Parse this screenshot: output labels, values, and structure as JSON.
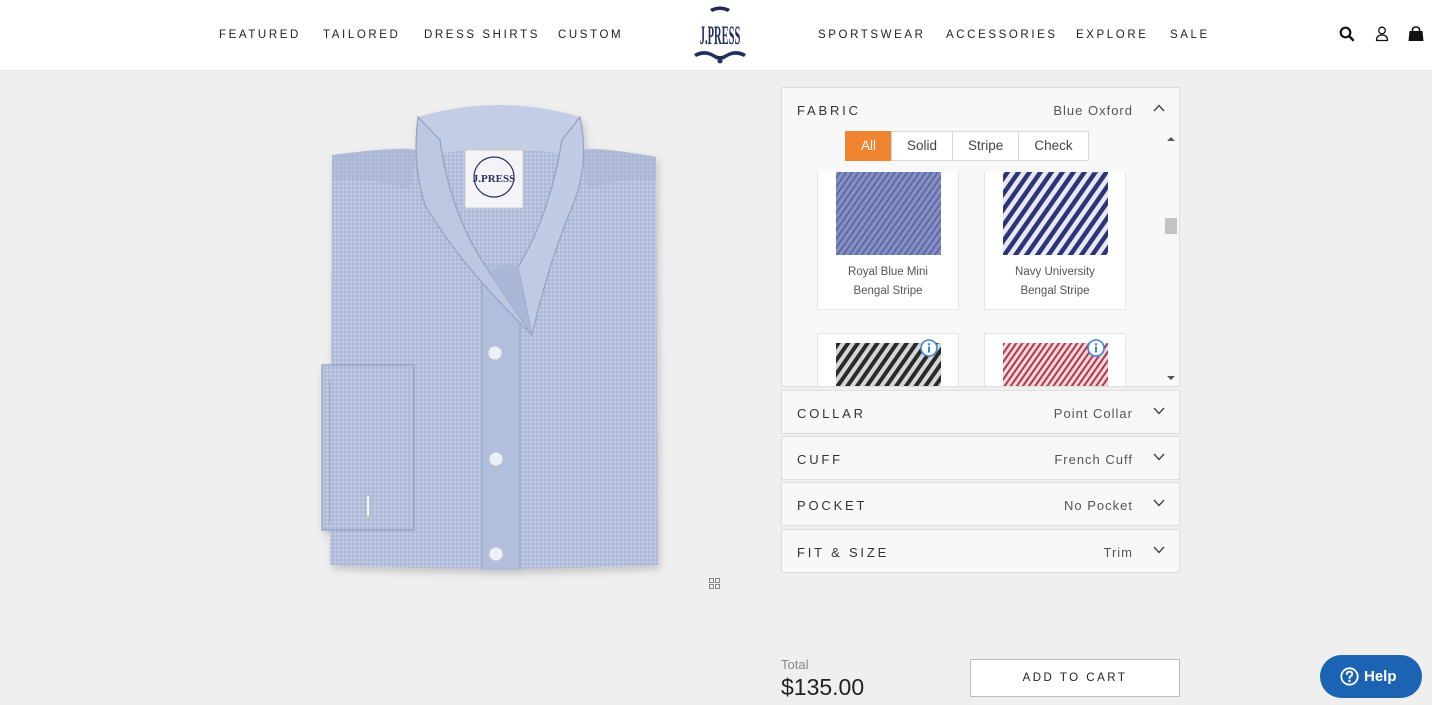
{
  "header": {
    "nav_left": [
      "FEATURED",
      "TAILORED",
      "DRESS SHIRTS",
      "CUSTOM"
    ],
    "nav_right": [
      "SPORTSWEAR",
      "ACCESSORIES",
      "EXPLORE",
      "SALE"
    ],
    "logo_text": "J.PRESS",
    "icons": [
      "search-icon",
      "account-icon",
      "cart-icon"
    ]
  },
  "product": {
    "image": "folded-blue-oxford-dress-shirt",
    "label_text": "J.PRESS"
  },
  "fabric": {
    "title": "FABRIC",
    "value": "Blue Oxford",
    "filters": [
      "All",
      "Solid",
      "Stripe",
      "Check"
    ],
    "active_filter": "All",
    "swatches": [
      {
        "line1": "Royal Blue Mini",
        "line2": "Bengal Stripe",
        "colors": [
          "#8790c2",
          "#5c6aa8"
        ]
      },
      {
        "line1": "Navy University",
        "line2": "Bengal Stripe",
        "colors": [
          "#e8e8f2",
          "#2c3578"
        ]
      },
      {
        "line1": "",
        "line2": "",
        "colors": [
          "#d6d6d6",
          "#2a2a2a"
        ]
      },
      {
        "line1": "",
        "line2": "",
        "colors": [
          "#f1d8dc",
          "#b03848"
        ]
      }
    ]
  },
  "options": [
    {
      "title": "COLLAR",
      "value": "Point Collar"
    },
    {
      "title": "CUFF",
      "value": "French Cuff"
    },
    {
      "title": "POCKET",
      "value": "No Pocket"
    },
    {
      "title": "FIT & SIZE",
      "value": "Trim"
    }
  ],
  "summary": {
    "total_label": "Total",
    "total_price": "$135.00",
    "add_to_cart": "ADD TO CART"
  },
  "help": {
    "label": "Help"
  },
  "colors": {
    "accent": "#ef8431",
    "help": "#1c63b3",
    "shirt": "#b6c2dd",
    "info": "#3d86d8"
  }
}
